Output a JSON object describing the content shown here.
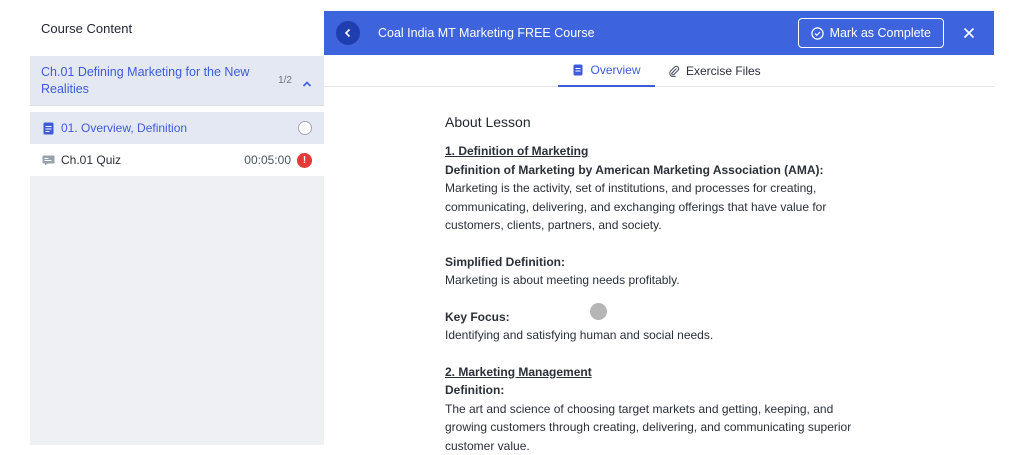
{
  "sidebar": {
    "header": "Course Content",
    "topic": {
      "title": "Ch.01 Defining Marketing for the New Realities",
      "count": "1/2"
    },
    "lessons": [
      {
        "title": "01. Overview, Definition",
        "time": ""
      },
      {
        "title": "Ch.01 Quiz",
        "time": "00:05:00"
      }
    ]
  },
  "topbar": {
    "course_title": "Coal India MT Marketing FREE Course",
    "complete_label": "Mark as Complete"
  },
  "tabs": [
    {
      "label": "Overview"
    },
    {
      "label": "Exercise Files"
    }
  ],
  "lesson": {
    "heading": "About Lesson",
    "s1_title": "1. Definition of Marketing",
    "s1_sub": "Definition of Marketing by American Marketing Association (AMA):",
    "s1_text1": "Marketing is the activity, set of institutions, and processes for creating,",
    "s1_text2": "communicating, delivering, and exchanging offerings that have value for",
    "s1_text3": "customers, clients, partners, and society.",
    "s2_title": "Simplified Definition:",
    "s2_text": "Marketing is about meeting needs profitably.",
    "s3_title": "Key Focus:",
    "s3_text": "Identifying and satisfying human and social needs.",
    "s4_title": "2. Marketing Management",
    "s4_sub": "Definition:",
    "s4_text1": "The art and science of choosing target markets and getting, keeping, and",
    "s4_text2": "growing customers through creating, delivering, and communicating superior",
    "s4_text3": "customer value."
  },
  "colors": {
    "accent": "#3d64dc",
    "alert": "#e53935"
  }
}
